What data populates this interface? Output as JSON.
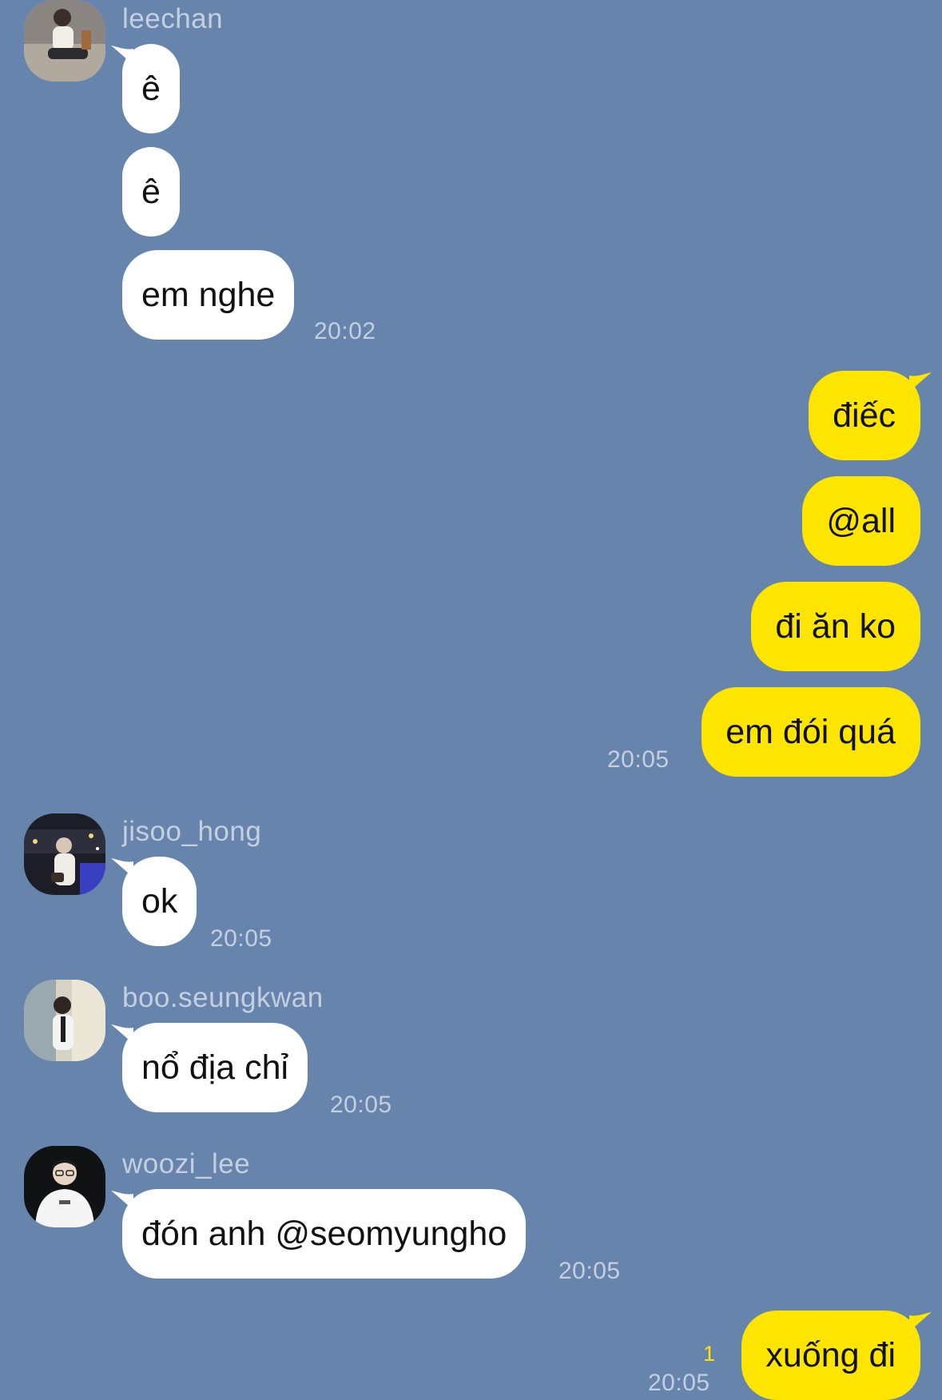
{
  "messages": {
    "leechan": {
      "sender": "leechan",
      "avatar_icon": "profile-photo",
      "lines": [
        "ê",
        "ê",
        "em nghe"
      ],
      "time": "20:02"
    },
    "me_1": {
      "lines": [
        "điếc",
        "@all",
        "đi ăn ko",
        "em đói quá"
      ],
      "time": "20:05"
    },
    "jisoo": {
      "sender": "jisoo_hong",
      "avatar_icon": "profile-photo",
      "lines": [
        "ok"
      ],
      "time": "20:05"
    },
    "boo": {
      "sender": "boo.seungkwan",
      "avatar_icon": "profile-photo",
      "lines": [
        "nổ địa chỉ"
      ],
      "time": "20:05"
    },
    "woozi": {
      "sender": "woozi_lee",
      "avatar_icon": "profile-photo",
      "lines": [
        "đón anh @seomyungho"
      ],
      "time": "20:05"
    },
    "me_2": {
      "lines": [
        "xuống đi"
      ],
      "unread": "1",
      "time": "20:05"
    }
  },
  "colors": {
    "background": "#6784ad",
    "incoming_bubble": "#ffffff",
    "outgoing_bubble": "#fee500",
    "meta_text": "#c4cfe0",
    "unread_count": "#fee500"
  }
}
